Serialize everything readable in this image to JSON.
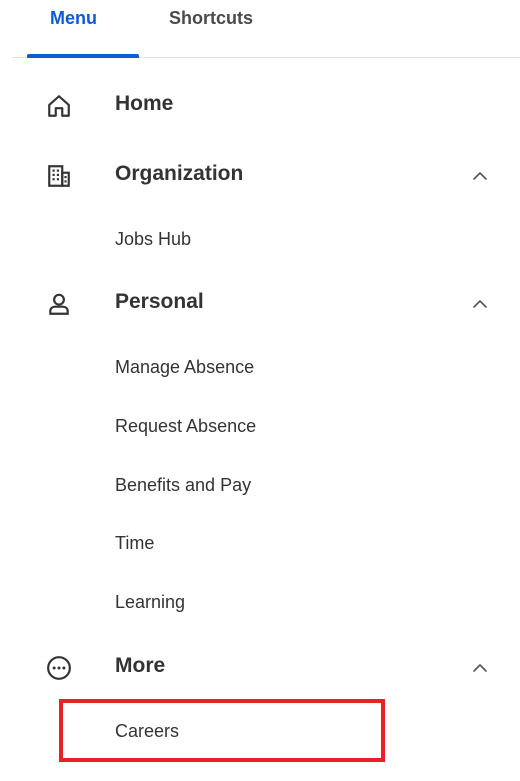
{
  "tabs": {
    "menu": "Menu",
    "shortcuts": "Shortcuts"
  },
  "sections": {
    "home": {
      "label": "Home",
      "icon": "home-icon"
    },
    "organization": {
      "label": "Organization",
      "icon": "building-icon",
      "expanded": true,
      "items": [
        "Jobs Hub"
      ]
    },
    "personal": {
      "label": "Personal",
      "icon": "person-icon",
      "expanded": true,
      "items": [
        "Manage Absence",
        "Request Absence",
        "Benefits and Pay",
        "Time",
        "Learning"
      ]
    },
    "more": {
      "label": "More",
      "icon": "more-icon",
      "expanded": true,
      "items": [
        "Careers"
      ]
    }
  },
  "colors": {
    "accent": "#0b5cd5",
    "highlight": "#e8202a",
    "text": "#333333"
  }
}
